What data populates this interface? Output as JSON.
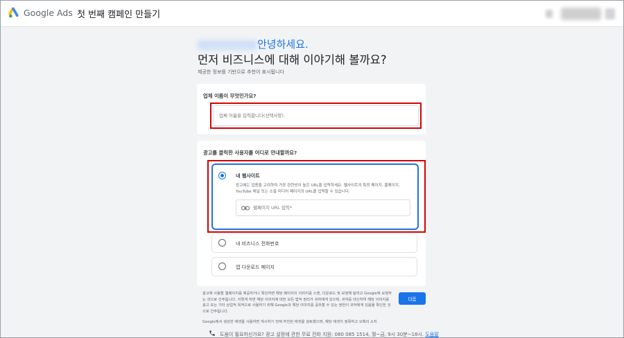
{
  "app": {
    "brand": "Google Ads",
    "campaign_title": "첫 번째 캠페인 만들기"
  },
  "header": {
    "greeting": "안녕하세요.",
    "question": "먼저 비즈니스에 대해 이야기해 볼까요?",
    "subtitle": "제공한 정보를 기반으로 추천이 표시됩니다"
  },
  "business": {
    "label": "업체 이름이 무엇인가요?",
    "placeholder": "업체 이름을 입력합니다(선택사항)."
  },
  "destination": {
    "label": "광고를 클릭한 사용자를 어디로 안내할까요?",
    "options": [
      {
        "label": "내 웹사이트",
        "selected": true,
        "description": "광고에는 업종을 고려하여 가장 관련성이 높은 URL을 입력하세요. 웹사이트의 특정 페이지, 홈페이지, YouTube 채널 또는 소셜 미디어 페이지의 URL을 입력할 수 있습니다.",
        "url_placeholder": "웹페이지 URL 입력*"
      },
      {
        "label": "내 비즈니스 전화번호",
        "selected": false
      },
      {
        "label": "앱 다운로드 페이지",
        "selected": false
      }
    ]
  },
  "legal": {
    "text": "광고에 사용할 웹페이지를 제공하거나 확인하면 해당 페이지의 이미지를 스캔, 다운로드 및 보정해 달라고 Google에 요청하는 것으로 간주됩니다. 이렇게 하면 해당 이미지에 대한 모든 법적 권리가 귀하에게 있으며, 귀하를 대신하여 해당 이미지를 광고 또는 기타 상업적 목적으로 사용하기 위해 Google과 해당 이미지를 공유할 수 있는 권한이 귀하에게 있음을 확인한 것으로 간주됩니다.",
    "note": "Google에서 생성한 애셋을 사용하면 게시하기 전에 추천된 애셋을 검토했으며, 해당 애셋이 정확하고 오해의 소지"
  },
  "next_label": "다음",
  "help": {
    "text": "도움이 필요하신가요? 광고 설정에 관한 무료 전화 지원: 080 085 1514, 월~금, 9시 30분~18시.",
    "link": "도움말"
  },
  "colors": {
    "accent": "#1a73e8",
    "annotation": "#d50000"
  }
}
